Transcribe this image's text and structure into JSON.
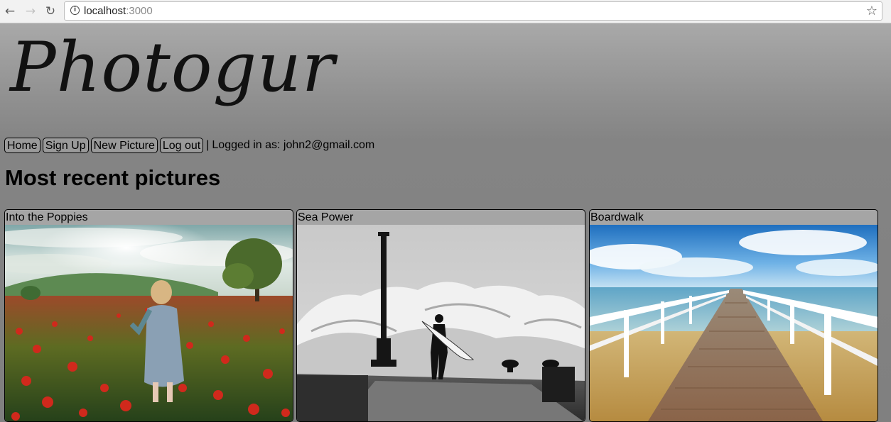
{
  "browser": {
    "back_icon": "back-arrow-icon",
    "forward_icon": "forward-arrow-icon",
    "reload_icon": "reload-icon",
    "url_host": "localhost",
    "url_port": ":3000",
    "bookmark_icon": "star-icon"
  },
  "site": {
    "logo": "Photogur"
  },
  "nav": {
    "items": [
      {
        "label": "Home"
      },
      {
        "label": "Sign Up"
      },
      {
        "label": "New Picture"
      },
      {
        "label": "Log out"
      }
    ],
    "separator": "|",
    "status": "Logged in as: john2@gmail.com"
  },
  "main": {
    "heading": "Most recent pictures",
    "pictures": [
      {
        "title": "Into the Poppies"
      },
      {
        "title": "Sea Power"
      },
      {
        "title": "Boardwalk"
      }
    ]
  }
}
